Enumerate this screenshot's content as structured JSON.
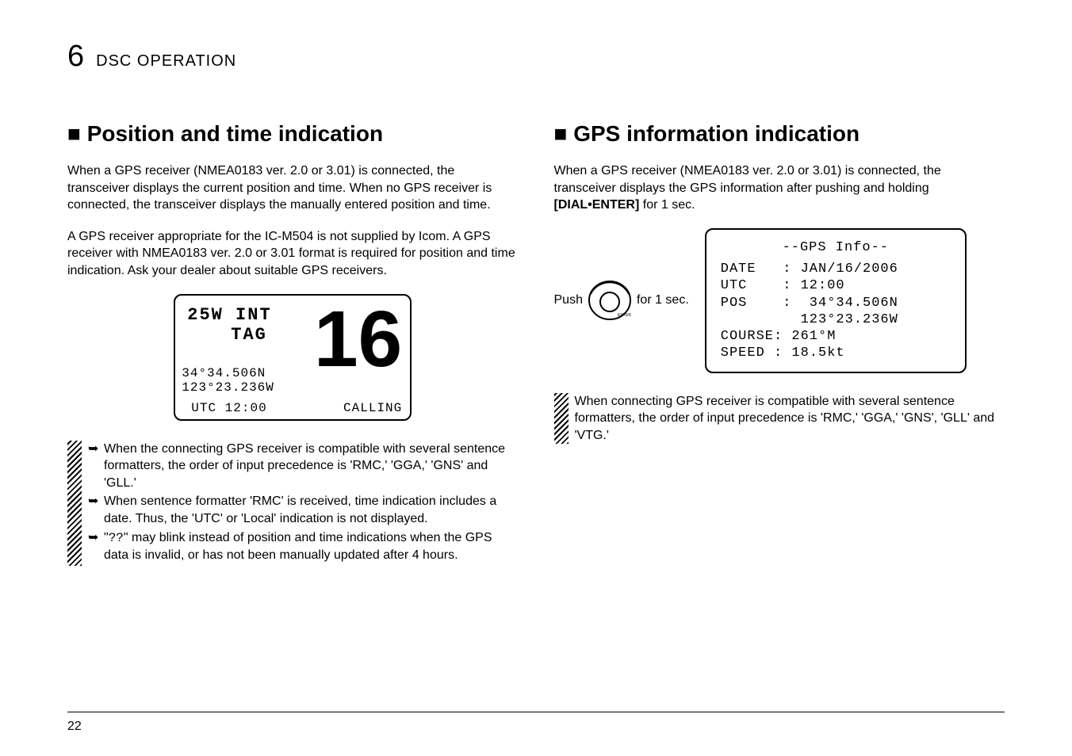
{
  "chapter": {
    "number": "6",
    "title": "DSC OPERATION"
  },
  "left": {
    "heading": "■ Position and time indication",
    "para1": "When a GPS receiver (NMEA0183 ver. 2.0 or 3.01) is connected, the transceiver displays the current position and time. When no GPS receiver is connected, the transceiver displays the manually entered position and time.",
    "para2": "A GPS receiver appropriate for the IC-M504 is not supplied by Icom. A GPS receiver with NMEA0183 ver. 2.0 or 3.01 format is required for position and time indication. Ask your dealer about suitable GPS receivers.",
    "lcd": {
      "top": "25W  INT",
      "tag": "TAG",
      "big": "16",
      "pos1": " 34°34.506N",
      "pos2": "123°23.236W",
      "utc": "UTC 12:00",
      "calling": "CALLING"
    },
    "notes": {
      "n1": "When the connecting GPS receiver is compatible with several sentence formatters, the order of input precedence is 'RMC,' 'GGA,' 'GNS' and 'GLL.'",
      "n2": "When sentence formatter 'RMC' is received, time indication includes a date. Thus, the 'UTC' or 'Local' indication is not displayed.",
      "n3a": "\"",
      "n3b": "??",
      "n3c": "\" may blink instead of position and time indications when the GPS data is invalid, or has not been manually updated after 4 hours."
    }
  },
  "right": {
    "heading": "■ GPS information indication",
    "para1a": "When a GPS receiver (NMEA0183 ver. 2.0 or 3.01) is connected, the transceiver displays the GPS information after pushing and holding ",
    "para1b": "[DIAL•ENTER]",
    "para1c": " for 1 sec.",
    "push": "Push",
    "forsec": "for 1 sec.",
    "enter": "ENTER",
    "lcd": {
      "title": "--GPS Info--",
      "l1": "DATE   : JAN/16/2006",
      "l2": "UTC    : 12:00",
      "l3": "POS    :  34°34.506N",
      "l4": "         123°23.236W",
      "l5": "COURSE: 261°M",
      "l6": "SPEED : 18.5kt"
    },
    "note": "When connecting GPS receiver is compatible with several sentence formatters, the order of input precedence is 'RMC,' 'GGA,' 'GNS', 'GLL' and 'VTG.'"
  },
  "page": "22"
}
